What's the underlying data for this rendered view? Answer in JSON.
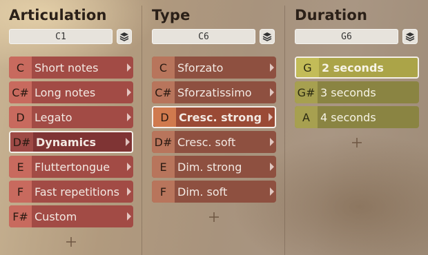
{
  "columns": [
    {
      "title": "Articulation",
      "selector_value": "C1",
      "items": [
        {
          "key": "C",
          "label": "Short notes"
        },
        {
          "key": "C#",
          "label": "Long notes"
        },
        {
          "key": "D",
          "label": "Legato"
        },
        {
          "key": "D#",
          "label": "Dynamics",
          "selected": true
        },
        {
          "key": "E",
          "label": "Fluttertongue"
        },
        {
          "key": "F",
          "label": "Fast repetitions"
        },
        {
          "key": "F#",
          "label": "Custom"
        }
      ]
    },
    {
      "title": "Type",
      "selector_value": "C6",
      "items": [
        {
          "key": "C",
          "label": "Sforzato"
        },
        {
          "key": "C#",
          "label": "Sforzatissimo"
        },
        {
          "key": "D",
          "label": "Cresc. strong",
          "selected": true
        },
        {
          "key": "D#",
          "label": "Cresc. soft"
        },
        {
          "key": "E",
          "label": "Dim. strong"
        },
        {
          "key": "F",
          "label": "Dim. soft"
        }
      ]
    },
    {
      "title": "Duration",
      "selector_value": "G6",
      "items": [
        {
          "key": "G",
          "label": "2 seconds",
          "selected": true
        },
        {
          "key": "G#",
          "label": "3 seconds"
        },
        {
          "key": "A",
          "label": "4 seconds"
        }
      ]
    }
  ],
  "icons": {
    "stack": "layers-icon",
    "arrow": "chevron-right-icon",
    "add": "plus-icon"
  },
  "colors": {
    "articulation_key": "#c86a5e",
    "articulation_label": "#a24b45",
    "articulation_selected_key": "#9e4a46",
    "articulation_selected_label": "#7f3434",
    "type_key": "#b8755c",
    "type_label": "#8e5040",
    "type_selected_key": "#d07a4e",
    "type_selected_label": "#9a4a35",
    "duration_key": "#a7a050",
    "duration_label": "#8a8442",
    "duration_selected_key": "#c3bc58",
    "duration_selected_label": "#aba448"
  }
}
